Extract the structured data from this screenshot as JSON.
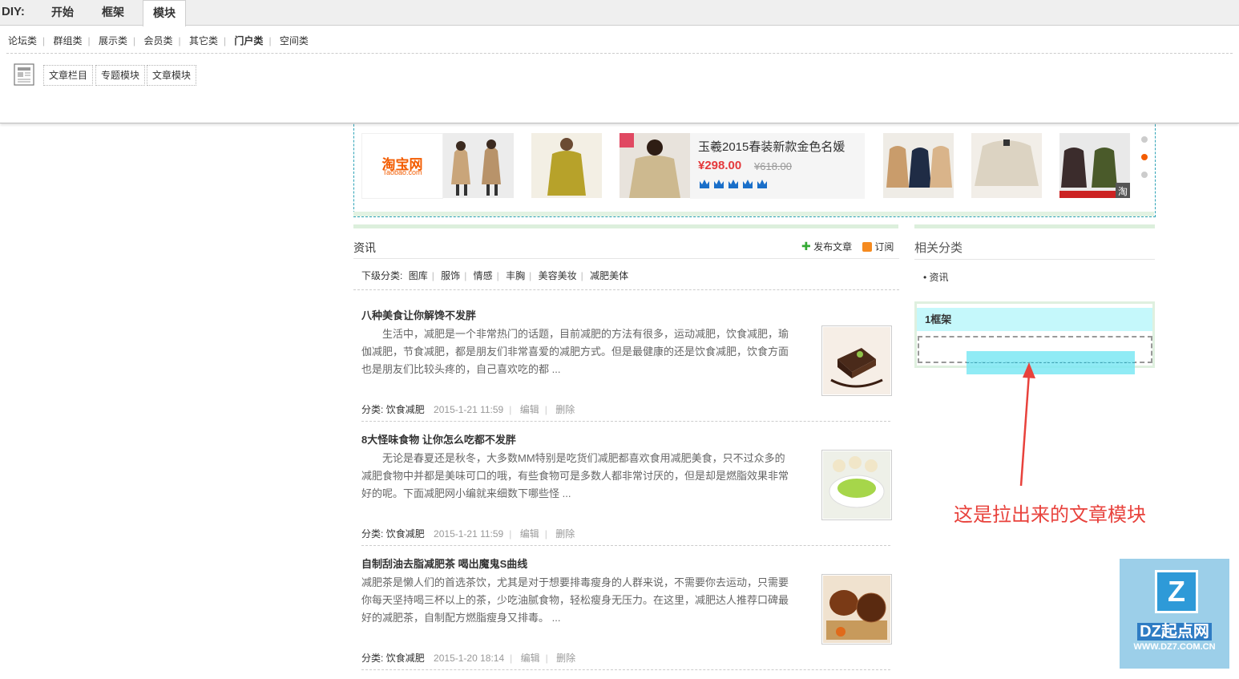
{
  "diy": {
    "label": "DIY:",
    "tabs": [
      {
        "label": "开始"
      },
      {
        "label": "框架"
      },
      {
        "label": "模块",
        "active": true
      }
    ],
    "categories": [
      "论坛类",
      "群组类",
      "展示类",
      "会员类",
      "其它类",
      "门户类",
      "空间类"
    ],
    "active_category": "门户类",
    "modules": [
      "文章栏目",
      "专题模块",
      "文章模块"
    ]
  },
  "banner": {
    "logo_text": "淘宝网",
    "logo_sub": "Taobao.com",
    "featured": {
      "name": "玉羲2015春装新款金色名媛",
      "price": "¥298.00",
      "original_price": "¥618.00"
    },
    "corner_badge": "淘"
  },
  "list": {
    "title": "资讯",
    "publish_label": "发布文章",
    "subscribe_label": "订阅",
    "subcat_label": "下级分类:",
    "subcats": [
      "图库",
      "服饰",
      "情感",
      "丰胸",
      "美容美妆",
      "减肥美体"
    ],
    "articles": [
      {
        "title": "八种美食让你解馋不发胖",
        "summary": "生活中，减肥是一个非常热门的话题，目前减肥的方法有很多，运动减肥，饮食减肥，瑜伽减肥，节食减肥，都是朋友们非常喜爱的减肥方式。但是最健康的还是饮食减肥，饮食方面也是朋友们比较头疼的，自己喜欢吃的都 ...",
        "category_label": "分类:",
        "category": "饮食减肥",
        "date": "2015-1-21 11:59",
        "edit": "编辑",
        "delete": "删除"
      },
      {
        "title": "8大怪味食物 让你怎么吃都不发胖",
        "summary": "无论是春夏还是秋冬，大多数MM特别是吃货们减肥都喜欢食用减肥美食，只不过众多的减肥食物中并都是美味可口的哦，有些食物可是多数人都非常讨厌的，但是却是燃脂效果非常好的呢。下面减肥网小编就来细数下哪些怪 ...",
        "category_label": "分类:",
        "category": "饮食减肥",
        "date": "2015-1-21 11:59",
        "edit": "编辑",
        "delete": "删除"
      },
      {
        "title": "自制刮油去脂减肥茶 喝出魔鬼S曲线",
        "summary": "减肥茶是懒人们的首选茶饮，尤其是对于想要排毒瘦身的人群来说，不需要你去运动，只需要你每天坚持喝三杯以上的茶，少吃油腻食物，轻松瘦身无压力。在这里，减肥达人推荐口碑最好的减肥茶，自制配方燃脂瘦身又排毒。 ...",
        "category_label": "分类:",
        "category": "饮食减肥",
        "date": "2015-1-20 18:14",
        "edit": "编辑",
        "delete": "删除"
      }
    ]
  },
  "sidebar": {
    "title": "相关分类",
    "item": "资讯",
    "frame_title": "1框架"
  },
  "annotation": "这是拉出来的文章模块",
  "watermark": {
    "mark": "Z",
    "name": "DZ起点网",
    "url": "WWW.DZ7.COM.CN"
  },
  "colors": {
    "accent_orange": "#f35c00",
    "price_red": "#e4393c",
    "frame_cyan": "#c5f8fb",
    "annotation_red": "#e8423c"
  }
}
